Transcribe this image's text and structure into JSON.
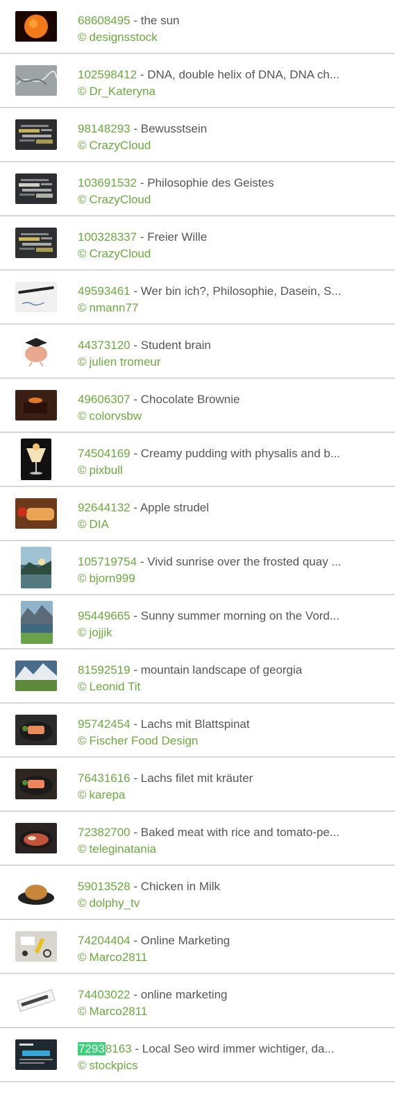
{
  "items": [
    {
      "id": "68608495",
      "title": "the sun",
      "author": "designsstock",
      "icon": "sun-image",
      "bg": "#1a0800",
      "accent": "#f27a1a",
      "shape": "wide"
    },
    {
      "id": "102598412",
      "title": "DNA, double helix of DNA, DNA ch...",
      "author": "Dr_Kateryna",
      "icon": "dna-image",
      "bg": "#9ea4a6",
      "accent": "#dfe3e4",
      "shape": "wide"
    },
    {
      "id": "98148293",
      "title": "Bewusstsein",
      "author": "CrazyCloud",
      "icon": "wordcloud-image",
      "bg": "#2b2d2e",
      "accent": "#c8b35a",
      "shape": "wide"
    },
    {
      "id": "103691532",
      "title": "Philosophie des Geistes",
      "author": "CrazyCloud",
      "icon": "wordcloud-image",
      "bg": "#2c2e2f",
      "accent": "#d0cfc4",
      "shape": "wide"
    },
    {
      "id": "100328337",
      "title": "Freier Wille",
      "author": "CrazyCloud",
      "icon": "wordcloud-image",
      "bg": "#2d2f30",
      "accent": "#c9b75a",
      "shape": "wide"
    },
    {
      "id": "49593461",
      "title": "Wer bin ich?, Philosophie, Dasein, S...",
      "author": "nmann77",
      "icon": "pen-paper-image",
      "bg": "#f0f0f0",
      "accent": "#222222",
      "shape": "wide"
    },
    {
      "id": "44373120",
      "title": "Student brain",
      "author": "julien tromeur",
      "icon": "brain-graduate-image",
      "bg": "#ffffff",
      "accent": "#e8a98f",
      "shape": "wide"
    },
    {
      "id": "49606307",
      "title": "Chocolate Brownie",
      "author": "colorvsbw",
      "icon": "brownie-image",
      "bg": "#3a1f14",
      "accent": "#e07a2a",
      "shape": "wide"
    },
    {
      "id": "74504169",
      "title": "Creamy pudding with physalis and b...",
      "author": "pixbull",
      "icon": "pudding-image",
      "bg": "#111111",
      "accent": "#f3c26a",
      "shape": "tall"
    },
    {
      "id": "92644132",
      "title": "Apple strudel",
      "author": "DIA",
      "icon": "strudel-image",
      "bg": "#6b3a1a",
      "accent": "#e8a353",
      "shape": "wide"
    },
    {
      "id": "105719754",
      "title": "Vivid sunrise over the frosted quay ...",
      "author": "bjorn999",
      "icon": "sunrise-image",
      "bg": "#3b6b7a",
      "accent": "#f2e1a0",
      "shape": "tall"
    },
    {
      "id": "95449665",
      "title": "Sunny summer morning on the Vord...",
      "author": "jojjik",
      "icon": "lake-image",
      "bg": "#3d6a7f",
      "accent": "#6aa14a",
      "shape": "tall2"
    },
    {
      "id": "81592519",
      "title": "mountain landscape of georgia",
      "author": "Leonid Tit",
      "icon": "mountain-image",
      "bg": "#4b6b8a",
      "accent": "#5c8a3a",
      "shape": "wide"
    },
    {
      "id": "95742454",
      "title": "Lachs mit Blattspinat",
      "author": "Fischer Food Design",
      "icon": "salmon-image",
      "bg": "#2a2a2a",
      "accent": "#e98b5a",
      "shape": "wide"
    },
    {
      "id": "76431616",
      "title": "Lachs filet mit kräuter",
      "author": "karepa",
      "icon": "salmon-image",
      "bg": "#2e2620",
      "accent": "#f0845a",
      "shape": "wide"
    },
    {
      "id": "72382700",
      "title": "Baked meat with rice and tomato-pe...",
      "author": "teleginatania",
      "icon": "meat-image",
      "bg": "#2a2220",
      "accent": "#c0533a",
      "shape": "wide"
    },
    {
      "id": "59013528",
      "title": "Chicken in Milk",
      "author": "dolphy_tv",
      "icon": "chicken-image",
      "bg": "#ffffff",
      "accent": "#c8863a",
      "shape": "wide"
    },
    {
      "id": "74204404",
      "title": "Online Marketing",
      "author": "Marco2811",
      "icon": "marketing-image",
      "bg": "#d9d6cf",
      "accent": "#333333",
      "shape": "wide"
    },
    {
      "id": "74403022",
      "title": "online marketing",
      "author": "Marco2811",
      "icon": "newspaper-image",
      "bg": "#ffffff",
      "accent": "#dddddd",
      "shape": "wide"
    },
    {
      "id": "72938163",
      "id_highlight": "7293",
      "id_rest": "8163",
      "title": "Local Seo wird immer wichtiger, da...",
      "author": "stockpics",
      "icon": "local-seo-image",
      "bg": "#1f2a30",
      "accent": "#38a7d8",
      "shape": "wide"
    }
  ],
  "copyright_symbol": "©",
  "separator": " - "
}
